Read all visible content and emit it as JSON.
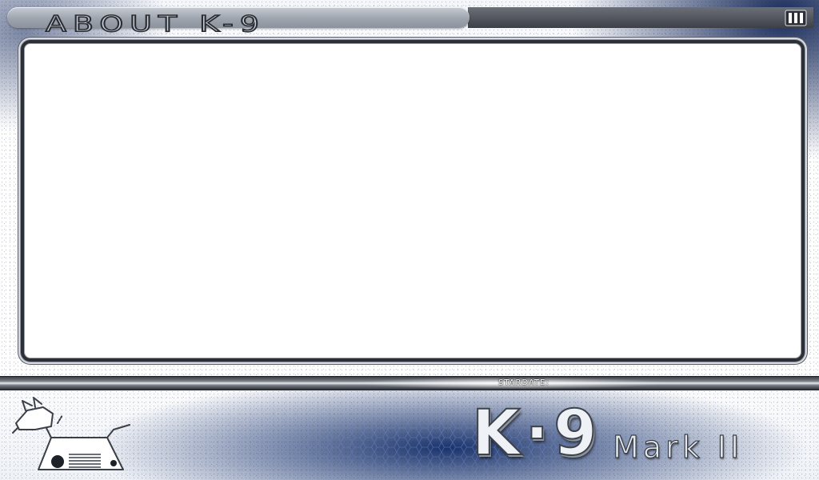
{
  "header": {
    "title": "ABOUT K-9",
    "menu_icon": "menu-bars-icon"
  },
  "content": {
    "body": ""
  },
  "status_bar": {
    "stardate_label": "STARDATE:",
    "stardate_value": ""
  },
  "footer": {
    "logo_main": "K·9",
    "logo_sub": "Mark II",
    "robot_icon": "k9-robot-dog-icon"
  },
  "colors": {
    "frame_dark": "#2c2f36",
    "panel": "#ffffff",
    "accent_blue": "#0e2864",
    "chrome_grey": "#9ea4ad"
  }
}
